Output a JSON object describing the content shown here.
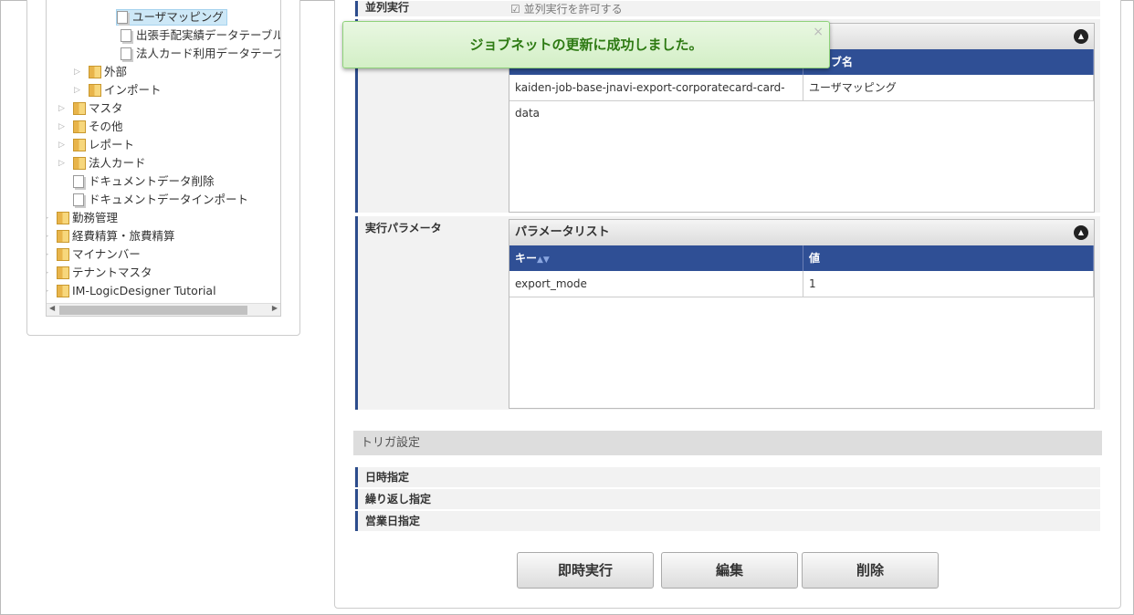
{
  "tree": [
    {
      "label": "ユーザマッピング",
      "type": "doc",
      "selected": true
    },
    {
      "label": "出張手配実績データテーブル",
      "type": "doc"
    },
    {
      "label": "法人カード利用データテーブル",
      "type": "doc"
    },
    {
      "label": "外部",
      "type": "folder"
    },
    {
      "label": "インポート",
      "type": "folder"
    },
    {
      "label": "マスタ",
      "type": "folder"
    },
    {
      "label": "その他",
      "type": "folder"
    },
    {
      "label": "レポート",
      "type": "folder"
    },
    {
      "label": "法人カード",
      "type": "folder"
    },
    {
      "label": "ドキュメントデータ削除",
      "type": "doc"
    },
    {
      "label": "ドキュメントデータインポート",
      "type": "doc"
    },
    {
      "label": "勤務管理",
      "type": "folder"
    },
    {
      "label": "経費精算・旅費精算",
      "type": "folder"
    },
    {
      "label": "マイナンバー",
      "type": "folder"
    },
    {
      "label": "テナントマスタ",
      "type": "folder"
    },
    {
      "label": "IM-LogicDesigner Tutorial",
      "type": "folder"
    }
  ],
  "parallel": {
    "label": "並列実行",
    "checkbox": "並列実行を許可する",
    "checked": true
  },
  "toast": {
    "message": "ジョブネットの更新に成功しました。",
    "close": "×"
  },
  "jobs_grid": {
    "col2": "ジョブ名",
    "rows": [
      [
        "kaiden-job-base-jnavi-export-corporatecard-card-data",
        "ユーザマッピング"
      ]
    ]
  },
  "params": {
    "label": "実行パラメータ",
    "title": "パラメータリスト",
    "col_key": "キー",
    "col_value": "値",
    "rows": [
      [
        "export_mode",
        "1"
      ]
    ]
  },
  "trigger": {
    "title": "トリガ設定",
    "rows": [
      "日時指定",
      "繰り返し指定",
      "営業日指定"
    ]
  },
  "buttons": {
    "run": "即時実行",
    "edit": "編集",
    "delete": "削除"
  }
}
